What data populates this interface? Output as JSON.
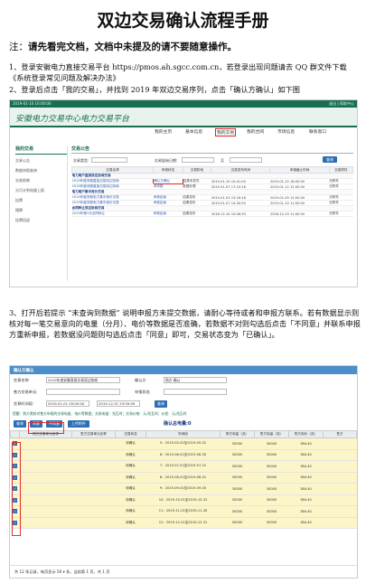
{
  "doc": {
    "title": "双边交易确认流程手册",
    "note_prefix": "注：",
    "note_text": "请先看完文档，文档中未提及的请不要随意操作。",
    "p1": "1、登录安徽电力直接交易平台 https://pmos.ah.sgcc.com.cn，若登录出现问题请去 QQ 群文件下载《系统登录常见问题及解决办法》",
    "p2": "2、登录后点击「我的交易」，并找到 2019 年双边交易序列，点击「确认方确认」如下图",
    "p3": "3、打开后若提示 “未查询到数据” 说明申报方未提交数据，请耐心等待或者和申报方联系。若有数据显示则核对每一笔交易意向的电量（分月）、电价等数据是否准确，若数据不对则勾选后点击「不同意」并联系申报方重新申报，若数据没问题则勾选后点击「同意」即可，交易状态变为「已确认」。"
  },
  "shot1": {
    "topbar_left": "2019-01-10 16:00:00",
    "topbar_right": "退出 | 帮助中心",
    "logo": "安徽电力交易中心电力交易平台",
    "nav": [
      "我的主页",
      "基本信息",
      "我的交易",
      "我的合同",
      "市场信息",
      "联系窗口"
    ],
    "side_header": "我的交易",
    "side_items": [
      "交易公告",
      "数据申报查询",
      "交易结果",
      "分月计划电量上报",
      "挂牌",
      "摘牌",
      "挂牌回退"
    ],
    "section": "交易公告",
    "filter_type_label": "交易类型:",
    "filter_date_label": "交易起始日期:",
    "filter_to": "至",
    "search_btn": "查询",
    "columns": [
      "交易名称",
      "申报状态",
      "交易阶段",
      "交易发布时间",
      "申报截止时间",
      "交易附件"
    ],
    "groups": [
      {
        "name": "电力用户直接双边协商交易",
        "rows": [
          {
            "name": "2019年度安徽直接交易双边协商",
            "status": "确认方确认",
            "stage": "结果未发布",
            "pub": "2019-01-10 10:41:00",
            "end": "2019-01-15 18:00:00",
            "att": "无附件"
          },
          {
            "name": "2019年度安徽直接交易双边协商",
            "status": "未申报",
            "stage": "数据处理",
            "pub": "2019-01-07 17:10:16",
            "end": "2019-01-12 12:00:00",
            "att": "无附件"
          }
        ]
      },
      {
        "name": "电力用户集中竞价交易",
        "rows": [
          {
            "name": "2019年度安徽电力集中竞价交易",
            "status": "申报结束",
            "stage": "结果发布",
            "pub": "2019-01-03 15:18:18",
            "end": "2019-01-09 12:00:00",
            "att": "无附件"
          },
          {
            "name": "2019年度安徽电力集中竞价交易",
            "status": "申报结束",
            "stage": "结果发布",
            "pub": "2019-01-07 14:30:50",
            "end": "2019-01-10 11:00:00",
            "att": "无附件"
          }
        ]
      },
      {
        "name": "合同转让双边协商交易",
        "rows": [
          {
            "name": "2019年第1次合同转让",
            "status": "申报结束",
            "stage": "结果发布",
            "pub": "2018-12-14 10:46:33",
            "end": "2018-12-19 11:00:00",
            "att": "无附件"
          }
        ]
      }
    ]
  },
  "shot2": {
    "title": "确认方确认",
    "trade_name_label": "交易名称",
    "trade_name_value": "2019年度安徽直接交易双边协商",
    "confirmer_label": "确认方",
    "confirmer_value": "购方 确认",
    "buyer_label": "售方交易单元:",
    "status_label": "申报状态",
    "period_label": "交易时间段:",
    "period_from": "2019-01-01 00:00:00",
    "period_to": "2019-12-31 23:59:59",
    "search_btn": "查询",
    "info": "提醒：购方需核对售方申报的交易电量、电价等数据；交易电量：兆瓦时；交易价格：元/兆瓦时；价差：元/兆瓦时",
    "btn_search": "查询",
    "btn_agree": "同意",
    "btn_disagree": "不同意",
    "btn_upload": "上传附件",
    "summary": "确认总电量:0",
    "columns": [
      "",
      "购方交易单元名称",
      "售方交易单元名称",
      "交易状态",
      "时间段",
      "购方电量（兆）",
      "售方电量（兆）",
      "购方电价（兆）",
      "售方"
    ],
    "rows": [
      {
        "state": "待确认",
        "period": "5：2019-05-01至2019-05-31",
        "b": "30000",
        "s": "30000",
        "p": "384.40"
      },
      {
        "state": "待确认",
        "period": "6：2019-06-01至2019-06-30",
        "b": "30000",
        "s": "30000",
        "p": "384.40"
      },
      {
        "state": "待确认",
        "period": "7：2019-07-01至2019-07-31",
        "b": "30000",
        "s": "30000",
        "p": "384.40"
      },
      {
        "state": "待确认",
        "period": "8：2019-08-01至2019-08-31",
        "b": "30000",
        "s": "30000",
        "p": "384.40"
      },
      {
        "state": "待确认",
        "period": "9：2019-09-01至2019-09-30",
        "b": "30000",
        "s": "30000",
        "p": "384.40"
      },
      {
        "state": "待确认",
        "period": "10：2019-10-01至2019-10-31",
        "b": "30000",
        "s": "30000",
        "p": "384.40"
      },
      {
        "state": "待确认",
        "period": "11：2019-11-01至2019-11-30",
        "b": "30000",
        "s": "30000",
        "p": "384.40"
      },
      {
        "state": "待确认",
        "period": "12：2019-12-01至2019-12-31",
        "b": "30000",
        "s": "30000",
        "p": "384.40"
      }
    ],
    "footer": "共 12 条记录，每页显示 50 ▾ 条，当前第 1 页，共 1 页"
  }
}
